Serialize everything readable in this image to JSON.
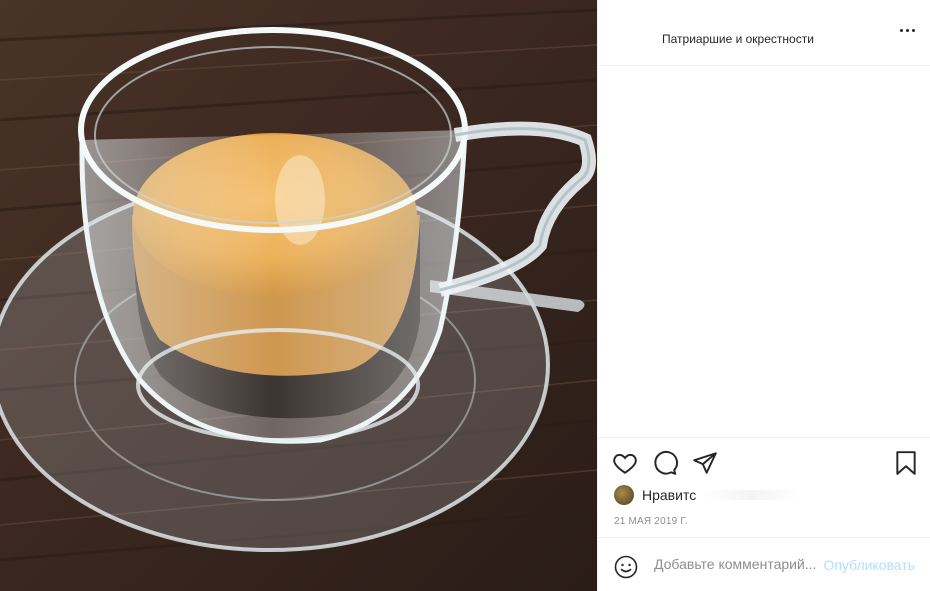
{
  "header": {
    "location": "Патриаршие и окрестности",
    "more_icon": "more-horizontal-icon"
  },
  "actions": {
    "like_icon": "heart-icon",
    "comment_icon": "comment-icon",
    "share_icon": "paper-plane-icon",
    "save_icon": "bookmark-icon"
  },
  "likes": {
    "text": "Нравитс",
    "suffix": ""
  },
  "date": "21 МАЯ 2019 Г.",
  "comment": {
    "placeholder": "Добавьте комментарий...",
    "publish_label": "Опубликовать"
  },
  "colors": {
    "publish": "#b2dffc",
    "border": "#efefef",
    "text": "#262626",
    "muted": "#8e8e8e"
  }
}
